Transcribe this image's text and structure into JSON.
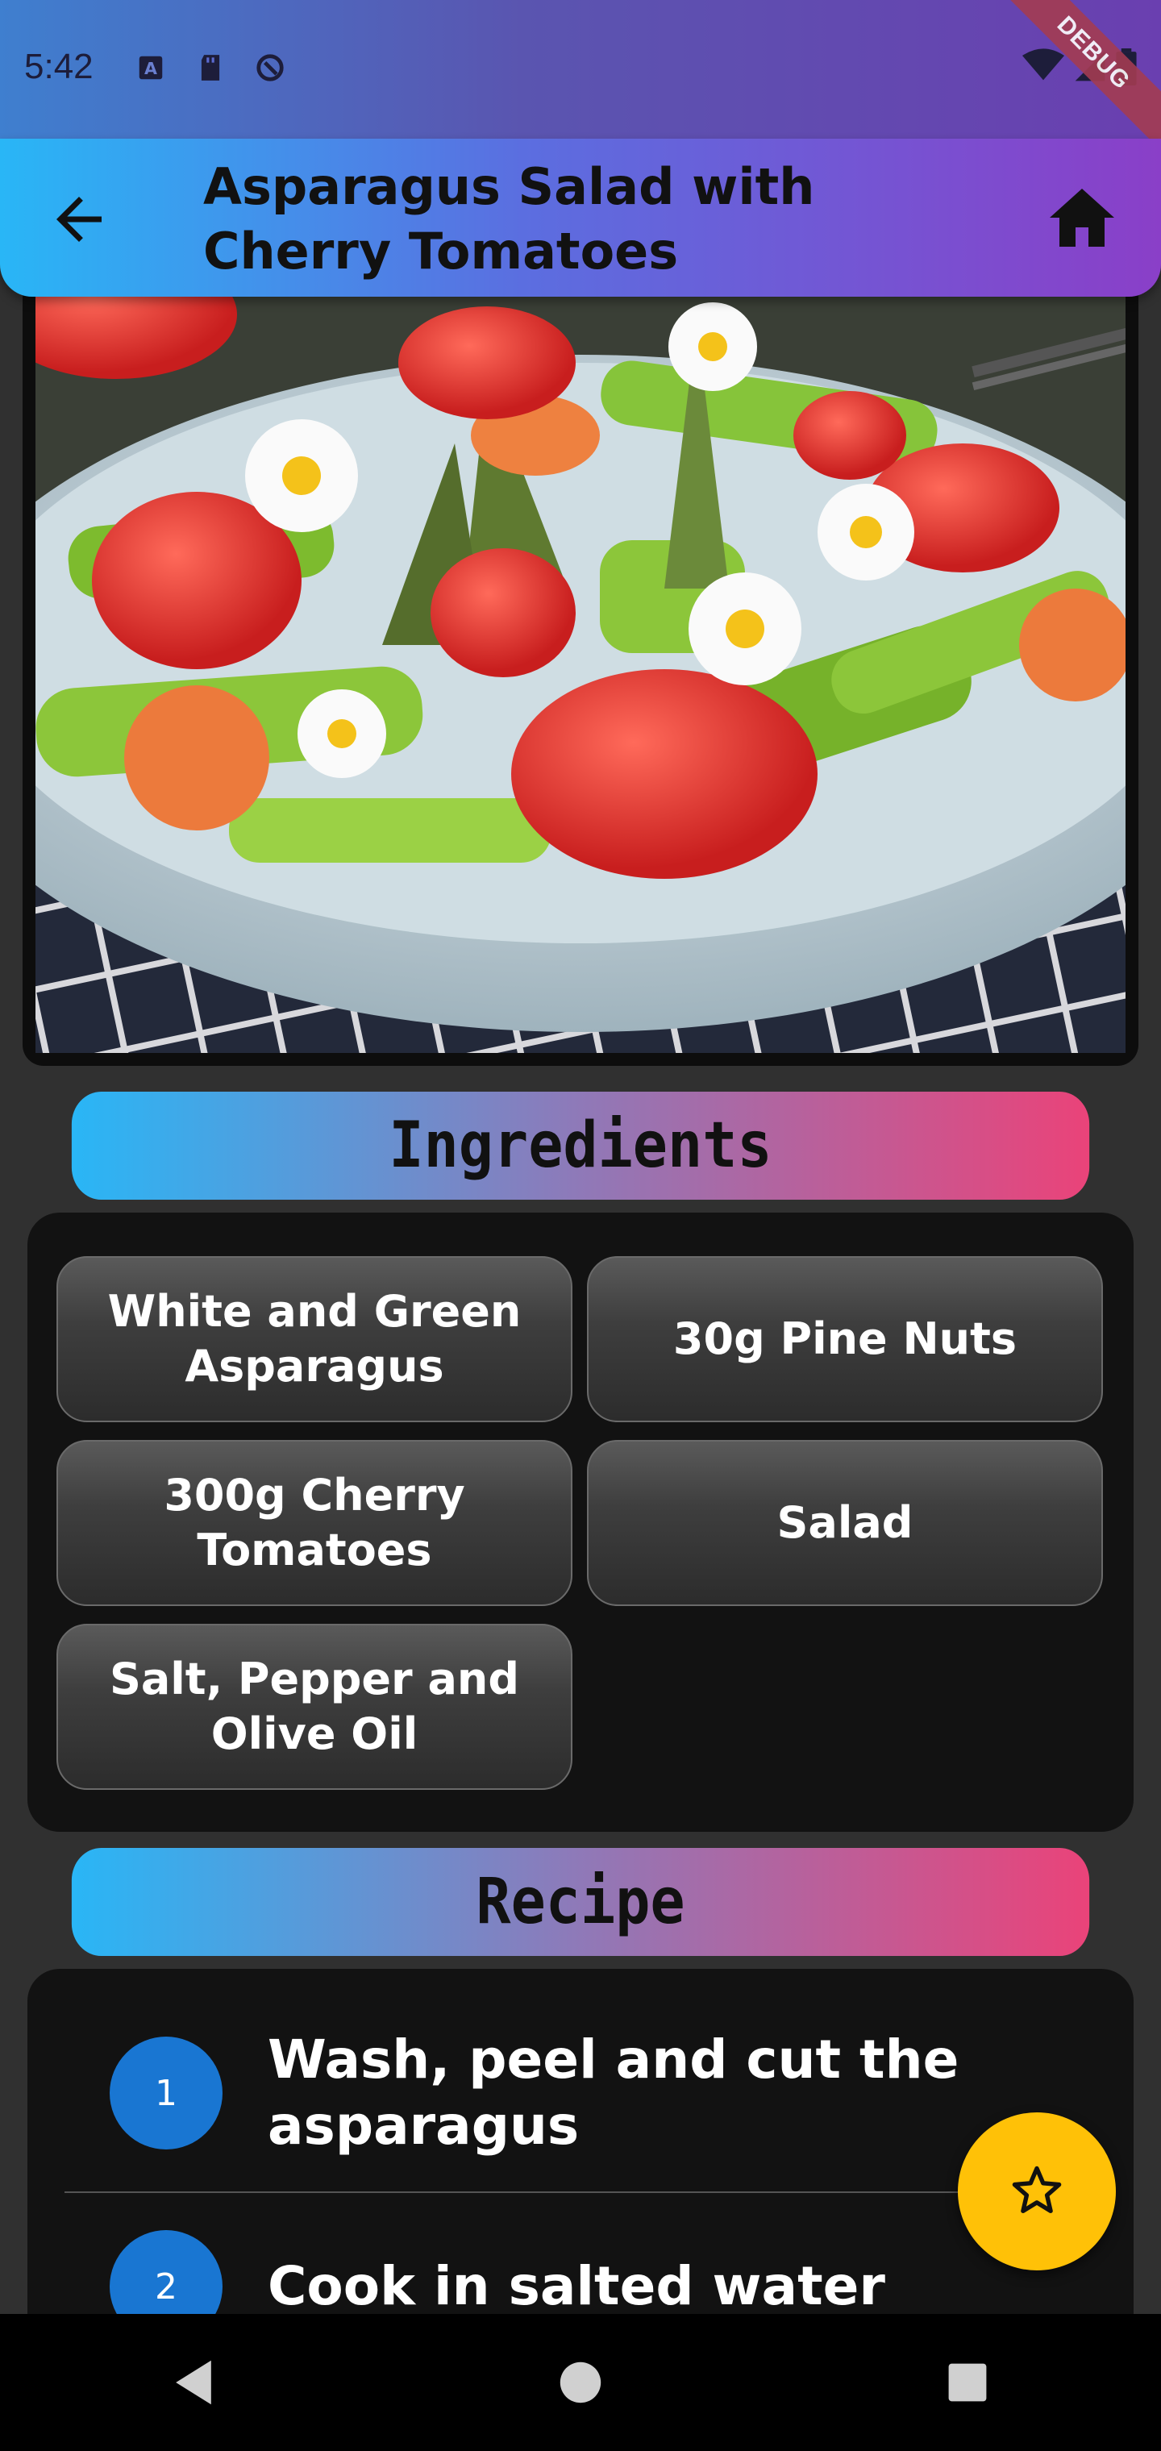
{
  "status_bar": {
    "time": "5:42",
    "left_icons": [
      "font-a-icon",
      "sd-card-icon",
      "vpn-key-icon"
    ],
    "right_icons": [
      "wifi-icon",
      "signal-icon",
      "battery-icon"
    ],
    "debug_banner": "DEBUG"
  },
  "app_bar": {
    "title": "Asparagus Salad with Cherry Tomatoes",
    "back_icon": "arrow-back-icon",
    "home_icon": "home-icon"
  },
  "hero": {
    "subject": "salad bowl"
  },
  "ingredients": {
    "header": "Ingredients",
    "items": [
      "White and Green Asparagus",
      "30g Pine Nuts",
      "300g Cherry Tomatoes",
      "Salad",
      "Salt, Pepper and Olive Oil"
    ]
  },
  "recipe": {
    "header": "Recipe",
    "steps": [
      {
        "num": "1",
        "text": "Wash, peel and cut the asparagus"
      },
      {
        "num": "2",
        "text": "Cook in salted water"
      }
    ]
  },
  "fab": {
    "icon": "star-outline-icon"
  },
  "nav_bar": {
    "icons": [
      "back-triangle-icon",
      "home-circle-icon",
      "recents-square-icon"
    ]
  },
  "colors": {
    "background": "#303030",
    "panel": "#121212",
    "accent_blue": "#29b6f6",
    "accent_pink": "#ea4379",
    "accent_purple": "#8a3fc8",
    "step_circle": "#1976d2",
    "fab": "#ffc107"
  }
}
